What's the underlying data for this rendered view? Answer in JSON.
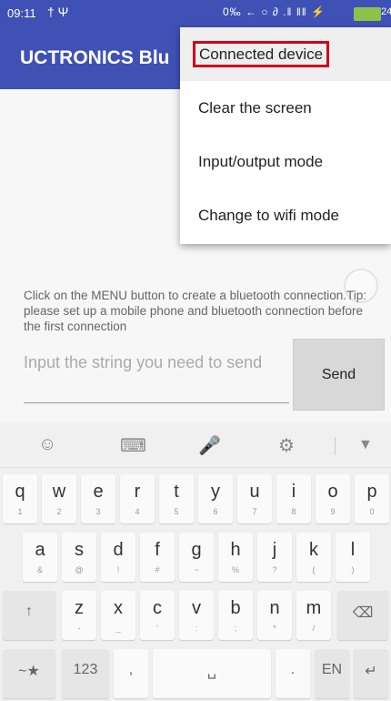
{
  "status": {
    "time": "09:11",
    "left_icons": "† Ψ",
    "right": "0‰ ← ○ ∂ .‖ ‖‖ ⚡",
    "battery": "24"
  },
  "app": {
    "title": "UCTRONICS Blu"
  },
  "menu": {
    "items": [
      {
        "label": "Connected device"
      },
      {
        "label": "Clear the screen"
      },
      {
        "label": "Input/output mode"
      },
      {
        "label": "Change to wifi mode"
      }
    ]
  },
  "tip": "Click on the MENU button to create a bluetooth connection.Tip: please set up a mobile phone and bluetooth connection before the first connection",
  "input": {
    "placeholder": "Input the string you need to send"
  },
  "send": {
    "label": "Send"
  },
  "keyboard": {
    "tools": [
      "☺",
      "⌨",
      "🎤",
      "⚙",
      "▼"
    ],
    "row1": [
      {
        "k": "q",
        "s": "1"
      },
      {
        "k": "w",
        "s": "2"
      },
      {
        "k": "e",
        "s": "3"
      },
      {
        "k": "r",
        "s": "4"
      },
      {
        "k": "t",
        "s": "5"
      },
      {
        "k": "y",
        "s": "6"
      },
      {
        "k": "u",
        "s": "7"
      },
      {
        "k": "i",
        "s": "8"
      },
      {
        "k": "o",
        "s": "9"
      },
      {
        "k": "p",
        "s": "0"
      }
    ],
    "row2": [
      {
        "k": "a",
        "s": "&"
      },
      {
        "k": "s",
        "s": "@"
      },
      {
        "k": "d",
        "s": "!"
      },
      {
        "k": "f",
        "s": "#"
      },
      {
        "k": "g",
        "s": "~"
      },
      {
        "k": "h",
        "s": "%"
      },
      {
        "k": "j",
        "s": "?"
      },
      {
        "k": "k",
        "s": "("
      },
      {
        "k": "l",
        "s": ")"
      }
    ],
    "row3": [
      {
        "k": "z",
        "s": "-"
      },
      {
        "k": "x",
        "s": "_"
      },
      {
        "k": "c",
        "s": "'"
      },
      {
        "k": "v",
        "s": ":"
      },
      {
        "k": "b",
        "s": ";"
      },
      {
        "k": "n",
        "s": "*"
      },
      {
        "k": "m",
        "s": "/"
      }
    ],
    "shift": "↑",
    "backspace": "⌫",
    "sym": "~★",
    "num": "123",
    "comma": ",",
    "space": "␣",
    "period": ".",
    "lang": "EN",
    "enter": "↵"
  }
}
